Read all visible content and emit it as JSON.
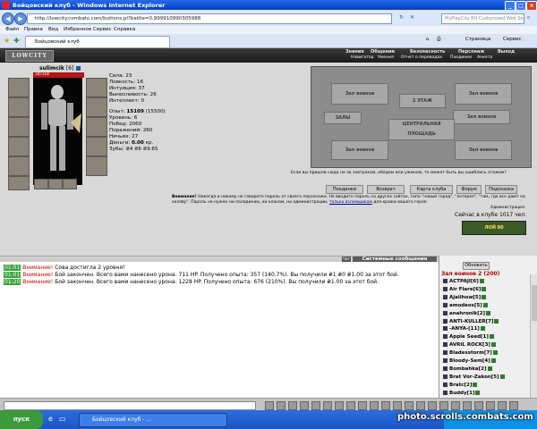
{
  "window": {
    "title": "Бойцовский клуб - Windows Internet Explorer",
    "min": "_",
    "max": "□",
    "close": "×"
  },
  "browser": {
    "url": "http://lowcity.combats.com/buttons.pl?battle=0.999910990305988",
    "search_placeholder": "MyPlayCity RU Customized Web Search",
    "menu": [
      "Файл",
      "Правка",
      "Вид",
      "Избранное",
      "Сервис",
      "Справка"
    ],
    "tab_title": "Бойцовский клуб",
    "commands": {
      "page": "Страница",
      "tools": "Сервис"
    }
  },
  "game": {
    "logo": "LOWCITY",
    "nav_top": [
      "Знания",
      "Общение",
      "Безопасность",
      "Персонаж",
      "Выход"
    ],
    "nav_sub": [
      "Навигатор",
      "Умения",
      "Отчет о переводах",
      "Поединки",
      "Анкета"
    ],
    "character": {
      "name": "sulimcik",
      "level": "[6]",
      "hp": "34/318"
    },
    "stats": [
      {
        "label": "Сила:",
        "value": "23"
      },
      {
        "label": "Ловкость:",
        "value": "16"
      },
      {
        "label": "Интуиция:",
        "value": "37"
      },
      {
        "label": "Выносливость:",
        "value": "26"
      },
      {
        "label": "Интеллект:",
        "value": "0"
      }
    ],
    "stats2": [
      {
        "label": "Опыт:",
        "value": "15109",
        "extra": "(15500)"
      },
      {
        "label": "Уровень:",
        "value": "6",
        "extra": ""
      },
      {
        "label": "Побед:",
        "value": "2060",
        "extra": ""
      },
      {
        "label": "Поражений:",
        "value": "260",
        "extra": ""
      },
      {
        "label": "Ничьих:",
        "value": "27",
        "extra": ""
      },
      {
        "label": "Деньги:",
        "value": "0.00",
        "extra": "кр."
      },
      {
        "label": "Зубы:",
        "value": "₴4 ₴6 ₴9.65",
        "extra": ""
      }
    ],
    "map": {
      "rooms": [
        "Зал воинов",
        "Зал воинов",
        "2 ЭТАЖ",
        "ЗАЛЫ",
        "Зал воинов",
        "ЦЕНТРАЛЬНАЯ ПЛОЩАДЬ",
        "Зал воинов",
        "Зал воинов"
      ],
      "note": "Если вы пришли сюда не за завтраком, обедом или ужином, то может быть вы ошиблись этажом?"
    },
    "buttons": [
      "Поединки",
      "Возврат",
      "Карта клуба",
      "Форум",
      "Подсказка"
    ],
    "warning_label": "Внимание!",
    "warning": "Никогда и никому не говорите пароль от своего персонажа. Не вводите пароль на других сайтах, типа \"новый город\", \"лотерея\", \"там, где все дают на халяву\". Пароль не нужен ни паладинам, ни кланам, ни администрации,",
    "warning_link": "только взломщикам",
    "warning_end": "для кражи вашего героя.",
    "admin": "Администрация.",
    "online": "Сейчас в клубе 1017 чел.",
    "counter": "ЛОЙ 80"
  },
  "chat": {
    "tab_short": "Чат",
    "tab_sys": "Системные сообщения",
    "lines": [
      {
        "time": "01:01",
        "warn": "Внимание!",
        "text": "Сова достигла 2 уровня!"
      },
      {
        "time": "01:01",
        "warn": "Внимание!",
        "text": "Бой закончен. Всего вами нанесено урона: 711 HP. Получено опыта: 357 (140.7%). Вы получили ₴1 ₴0 ₴1.00 за этот бой."
      },
      {
        "time": "01:20",
        "warn": "Внимание!",
        "text": "Бой закончен. Всего вами нанесено урона: 1228 HP. Получено опыта: 676 (210%). Вы получили ₴1.00 за этот бой."
      }
    ]
  },
  "room": {
    "refresh": "Обновить",
    "title": "Зал воинов 2 (200)",
    "players": [
      "ACTPAJI[6]",
      "Air Flare[6]",
      "Ajaiihow[5]",
      "amodeos[5]",
      "anahronik[2]",
      "ANTI-KULLER[7]",
      "-ANYA-[11]",
      "Apple Seed[1]",
      "AVRIL ROCK[3]",
      "Bladesstorm[7]",
      "Bloody-Sem[4]",
      "Bombahka[2]",
      "Brat Vor-Zakon[5]",
      "Bratc[2]",
      "Buddy[1]"
    ]
  },
  "taskbar": {
    "start": "пуск",
    "item": "Бойцовский клуб - ..."
  },
  "watermark": "photo.scrolls.combats.com"
}
